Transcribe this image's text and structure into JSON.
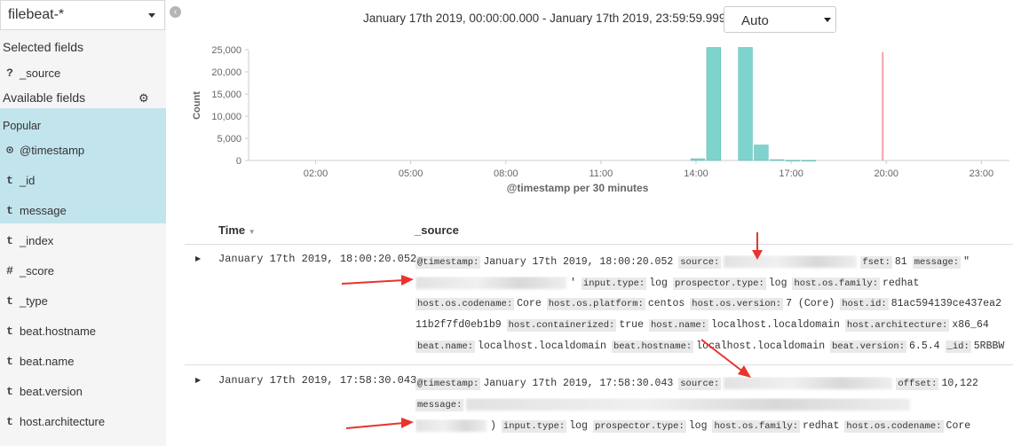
{
  "sidebar": {
    "index_pattern": "filebeat-*",
    "selected_heading": "Selected fields",
    "selected_fields": [
      {
        "type": "?",
        "name": "_source"
      }
    ],
    "available_heading": "Available fields",
    "popular_heading": "Popular",
    "popular_fields": [
      {
        "type": "⊙",
        "name": "@timestamp"
      },
      {
        "type": "t",
        "name": "_id"
      },
      {
        "type": "t",
        "name": "message"
      }
    ],
    "fields": [
      {
        "type": "t",
        "name": "_index"
      },
      {
        "type": "#",
        "name": "_score"
      },
      {
        "type": "t",
        "name": "_type"
      },
      {
        "type": "t",
        "name": "beat.hostname"
      },
      {
        "type": "t",
        "name": "beat.name"
      },
      {
        "type": "t",
        "name": "beat.version"
      },
      {
        "type": "t",
        "name": "host.architecture"
      }
    ]
  },
  "header": {
    "time_range": "January 17th 2019, 00:00:00.000 - January 17th 2019, 23:59:59.999 —",
    "interval": "Auto"
  },
  "chart_data": {
    "type": "bar",
    "ylabel": "Count",
    "xlabel": "@timestamp per 30 minutes",
    "ylim": [
      0,
      26000
    ],
    "yticks": [
      0,
      5000,
      10000,
      15000,
      20000,
      25000
    ],
    "ytick_labels": [
      "0",
      "5,000",
      "10,000",
      "15,000",
      "20,000",
      "25,000"
    ],
    "xticks_hours": [
      2,
      5,
      8,
      11,
      14,
      17,
      20,
      23
    ],
    "xtick_labels": [
      "02:00",
      "05:00",
      "08:00",
      "11:00",
      "14:00",
      "17:00",
      "20:00",
      "23:00"
    ],
    "bars": [
      {
        "hour": 14.0,
        "value": 400
      },
      {
        "hour": 14.5,
        "value": 25500
      },
      {
        "hour": 15.5,
        "value": 25500
      },
      {
        "hour": 16.0,
        "value": 3500
      },
      {
        "hour": 16.5,
        "value": 200
      },
      {
        "hour": 17.0,
        "value": 60
      },
      {
        "hour": 17.5,
        "value": 40
      }
    ],
    "marker_hour": 20.0,
    "bar_color": "#7ed3cd",
    "marker_color": "#f2a3a6"
  },
  "table": {
    "col_time": "Time",
    "col_source": "_source",
    "rows": [
      {
        "time": "January 17th 2019, 18:00:20.052",
        "lines": [
          [
            [
              "k",
              "@timestamp:"
            ],
            [
              "v",
              "January 17th 2019, 18:00:20.052"
            ],
            [
              "k",
              "source:"
            ],
            [
              "b",
              "150"
            ],
            [
              "k",
              "fset:"
            ],
            [
              "v",
              "81"
            ],
            [
              "k",
              "message:"
            ],
            [
              "v",
              "\""
            ]
          ],
          [
            [
              "b",
              "170"
            ],
            [
              "v",
              "'"
            ],
            [
              "k",
              "input.type:"
            ],
            [
              "v",
              "log"
            ],
            [
              "k",
              "prospector.type:"
            ],
            [
              "v",
              "log"
            ],
            [
              "k",
              "host.os.family:"
            ],
            [
              "v",
              "redhat"
            ]
          ],
          [
            [
              "k",
              "host.os.codename:"
            ],
            [
              "v",
              "Core"
            ],
            [
              "k",
              "host.os.platform:"
            ],
            [
              "v",
              "centos"
            ],
            [
              "k",
              "host.os.version:"
            ],
            [
              "v",
              "7 (Core)"
            ],
            [
              "k",
              "host.id:"
            ],
            [
              "v",
              "81ac594139ce437ea2"
            ]
          ],
          [
            [
              "v",
              "11b2f7fd0eb1b9"
            ],
            [
              "k",
              "host.containerized:"
            ],
            [
              "v",
              "true"
            ],
            [
              "k",
              "host.name:"
            ],
            [
              "v",
              "localhost.localdomain"
            ],
            [
              "k",
              "host.architecture:"
            ],
            [
              "v",
              "x86_64"
            ]
          ],
          [
            [
              "k",
              "beat.name:"
            ],
            [
              "v",
              "localhost.localdomain"
            ],
            [
              "k",
              "beat.hostname:"
            ],
            [
              "v",
              "localhost.localdomain"
            ],
            [
              "k",
              "beat.version:"
            ],
            [
              "v",
              "6.5.4"
            ],
            [
              "k",
              "_id:"
            ],
            [
              "v",
              "5RBBW"
            ]
          ]
        ]
      },
      {
        "time": "January 17th 2019, 17:58:30.043",
        "lines": [
          [
            [
              "k",
              "@timestamp:"
            ],
            [
              "v",
              "January 17th 2019, 17:58:30.043"
            ],
            [
              "k",
              "source:"
            ],
            [
              "b",
              "190"
            ],
            [
              "k",
              "offset:"
            ],
            [
              "v",
              "10,122"
            ]
          ],
          [
            [
              "k",
              "message:"
            ],
            [
              "b",
              "500"
            ]
          ],
          [
            [
              "b",
              "80"
            ],
            [
              "v",
              ")"
            ],
            [
              "k",
              "input.type:"
            ],
            [
              "v",
              "log"
            ],
            [
              "k",
              "prospector.type:"
            ],
            [
              "v",
              "log"
            ],
            [
              "k",
              "host.os.family:"
            ],
            [
              "v",
              "redhat"
            ],
            [
              "k",
              "host.os.codename:"
            ],
            [
              "v",
              "Core"
            ]
          ]
        ]
      }
    ]
  }
}
